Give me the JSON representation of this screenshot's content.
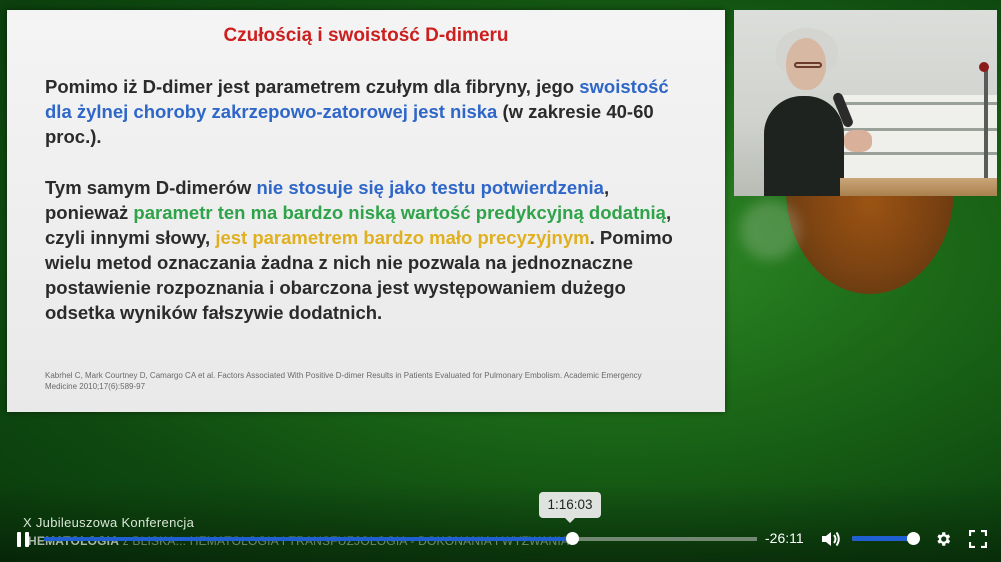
{
  "slide": {
    "title": "Czułością i swoistość  D-dimeru",
    "p1": {
      "s1": "Pomimo iż D-dimer jest parametrem czułym dla fibryny, jego ",
      "s2": "swoistość dla żylnej choroby zakrzepowo-zatorowej jest niska",
      "s3": " (w zakresie 40-60 proc.)."
    },
    "p2": {
      "s1": "Tym samym D-dimerów ",
      "s2": "nie stosuje się jako testu potwierdzenia",
      "s3": ", ponieważ ",
      "s4": "parametr ten ma bardzo niską wartość predykcyjną dodatnią",
      "s5": ", czyli innymi słowy, ",
      "s6": "jest parametrem bardzo mało precyzyjnym",
      "s7": ". Pomimo wielu metod oznaczania żadna z nich nie pozwala na jednoznaczne postawienie rozpoznania i obarczona jest występowaniem dużego odsetka wyników fałszywie dodatnich."
    },
    "reference": "Kabrhel C, Mark Courtney D, Camargo CA et al. Factors Associated With Positive D-dimer Results in Patients Evaluated for Pulmonary Embolism. Academic Emergency Medicine 2010;17(6):589-97"
  },
  "overlay": {
    "conference_name": "X Jubileuszowa Konferencja",
    "ticker_bold": "HEMATOLOGIA",
    "ticker_rest": " z BLISKA...  HEMATOLOGIA I TRANSFUZJOLOGIA - DOKONANIA I WYZWANIA"
  },
  "player": {
    "tooltip_time": "1:16:03",
    "time_remaining": "-26:11",
    "progress_fraction": 0.74,
    "volume_fraction": 0.9,
    "accent_color": "#1f5fd1",
    "icons": {
      "play_pause": "pause-icon",
      "volume": "volume-icon",
      "settings": "gear-icon",
      "fullscreen": "fullscreen-icon"
    }
  }
}
